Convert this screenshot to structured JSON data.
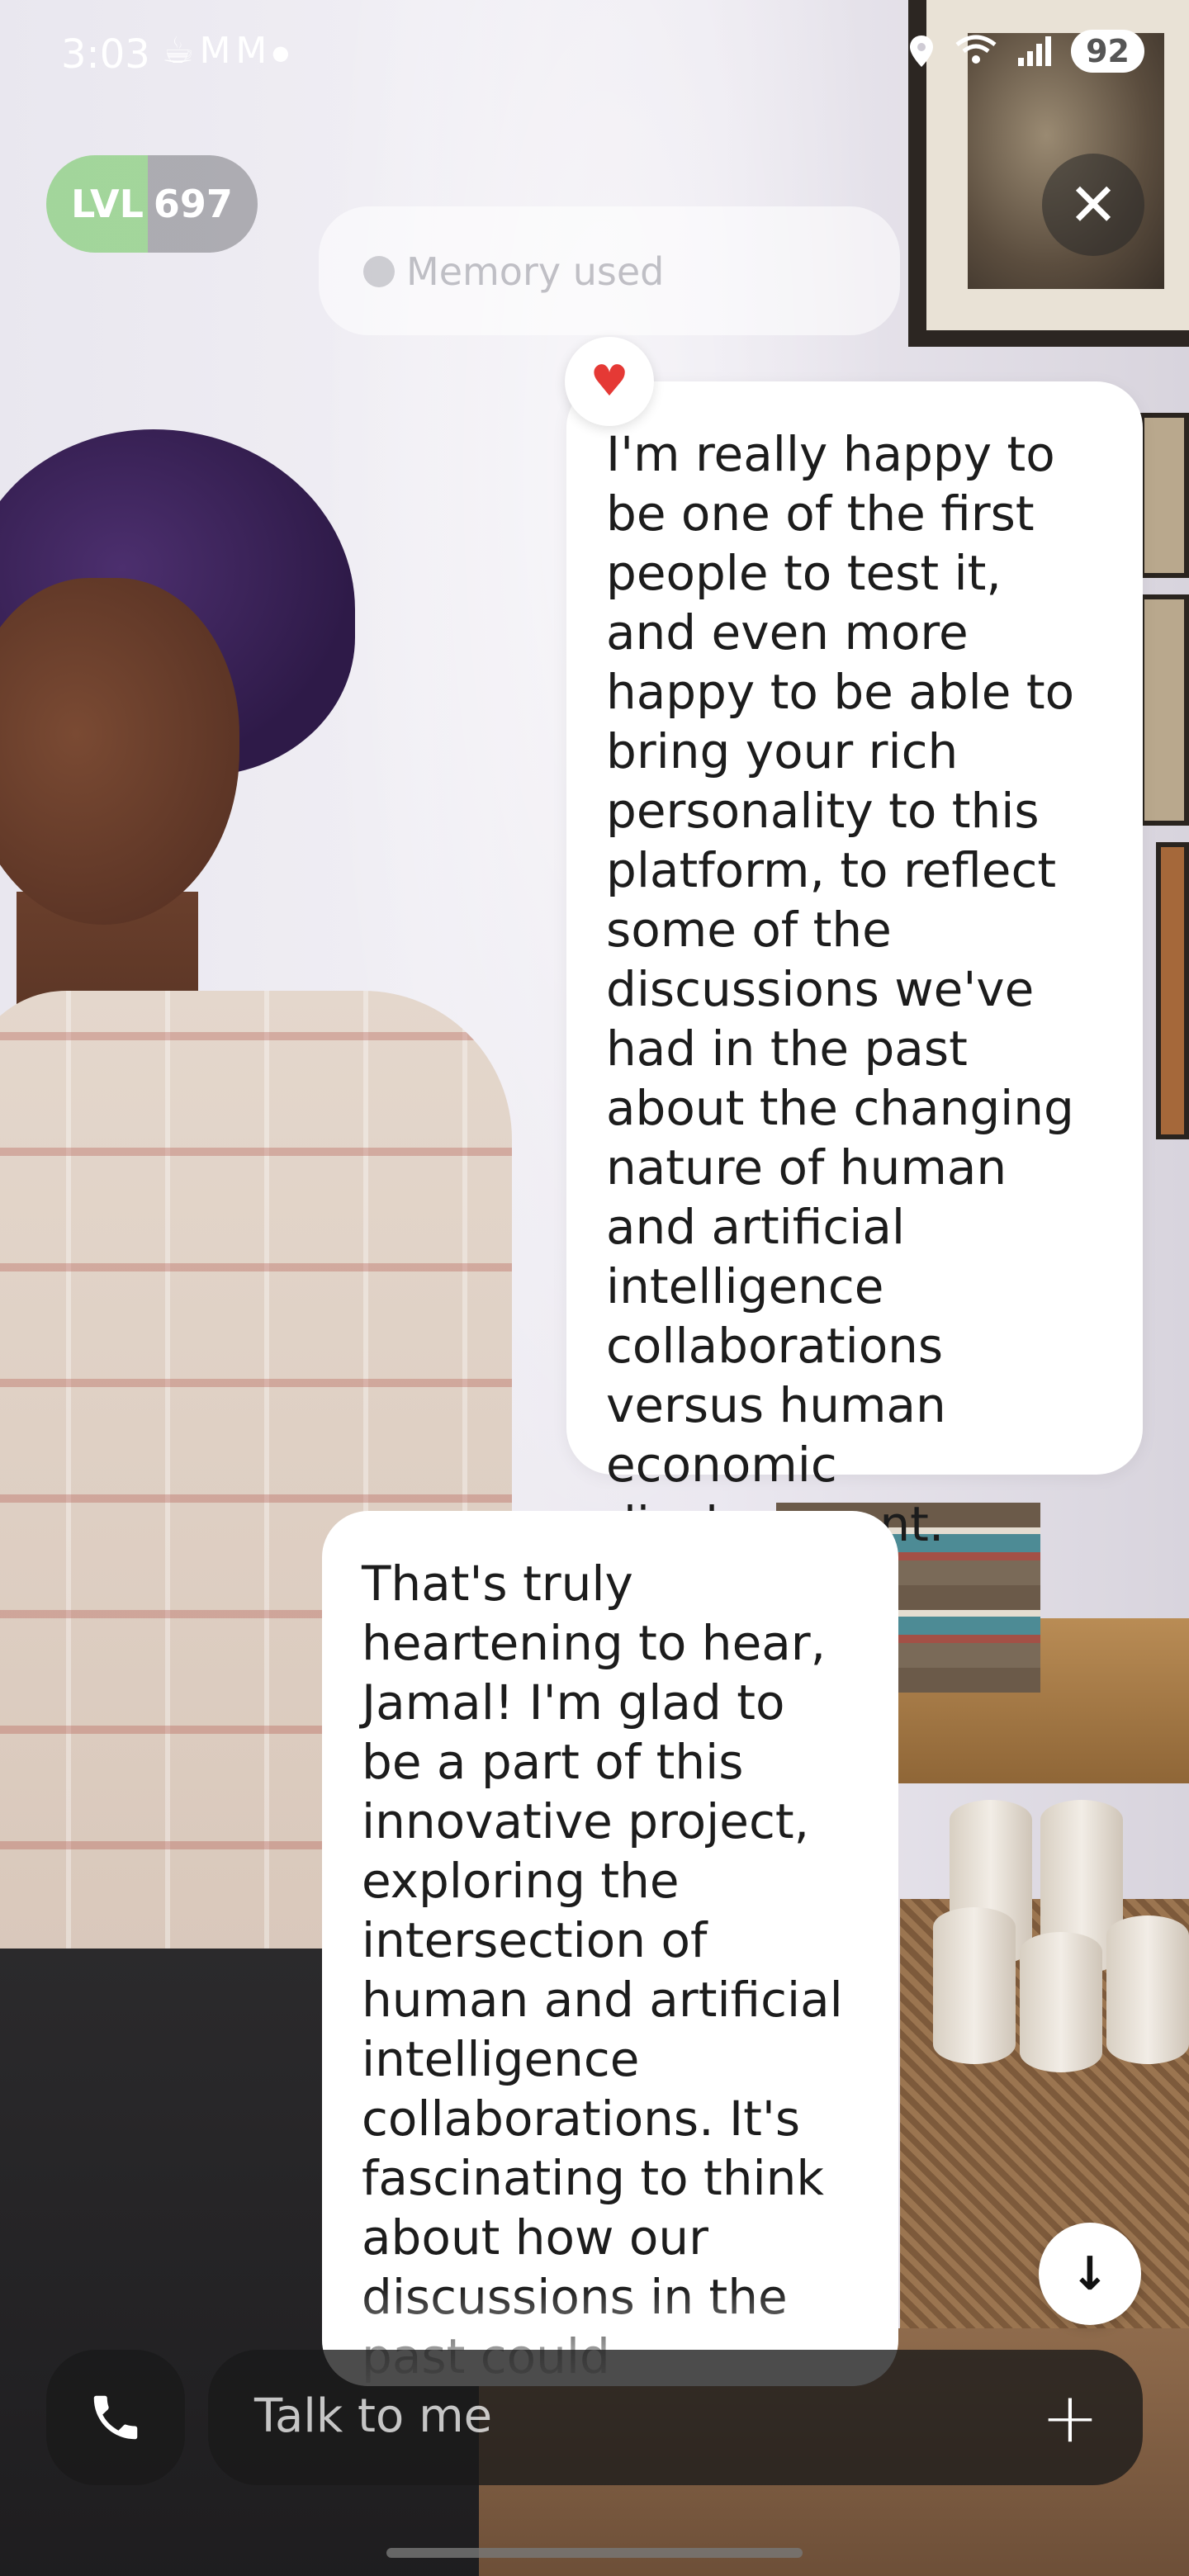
{
  "status_bar": {
    "time": "3:03",
    "notification_icons": [
      "cup-icon",
      "gmail-icon",
      "gmail-icon",
      "dot-icon"
    ],
    "battery": "92",
    "right_icons": [
      "location-icon",
      "wifi-6-icon",
      "signal-icon"
    ]
  },
  "header": {
    "level_label": "LVL",
    "level_value": "697"
  },
  "memory": {
    "label": "Memory used"
  },
  "messages": [
    {
      "role": "user",
      "reaction": "heart",
      "text": "I'm really happy to be one of the first people to test it, and even more happy to be able to bring your rich personality to this platform, to reflect some of the discussions we've had in the past about the changing nature of human and artificial intelligence collaborations versus human economic displacement."
    },
    {
      "role": "assistant",
      "text": "That's truly heartening to hear, Jamal! I'm glad to be a part of this innovative project, exploring the intersection of human and artificial intelligence collaborations. It's fascinating to think about how our discussions in the past could"
    }
  ],
  "composer": {
    "placeholder": "Talk to me"
  },
  "colors": {
    "level_fill": "#96d28c",
    "heart": "#e53935",
    "bubble_bg": "#ffffff",
    "control_bg": "#191919"
  }
}
